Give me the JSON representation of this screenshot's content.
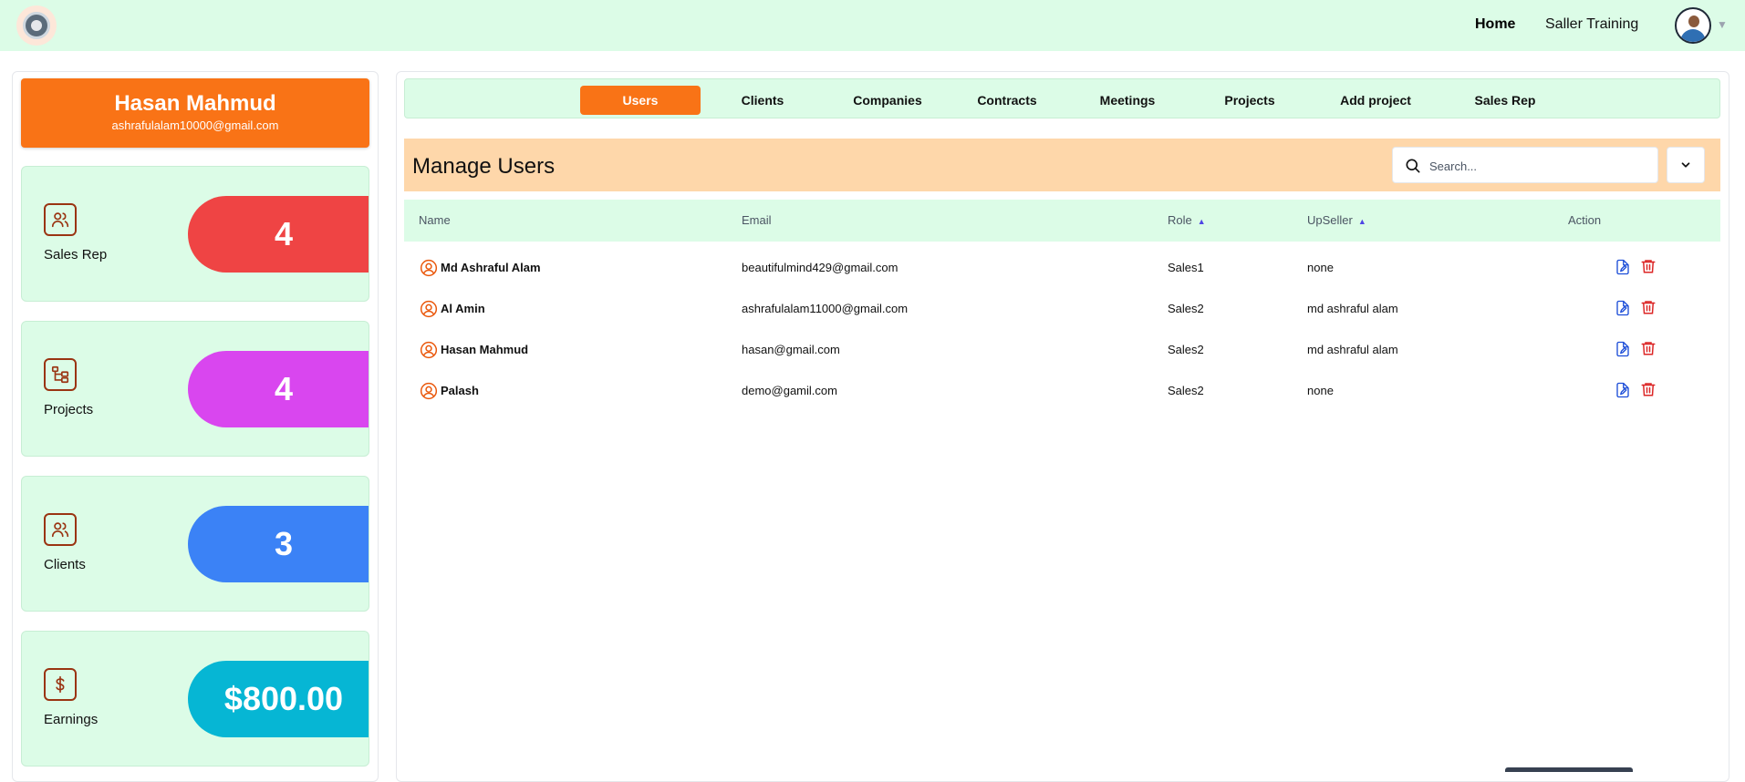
{
  "topbar": {
    "nav": {
      "home": "Home",
      "training": "Saller Training"
    }
  },
  "profile": {
    "name": "Hasan Mahmud",
    "email": "ashrafulalam10000@gmail.com"
  },
  "stats": [
    {
      "label": "Sales Rep",
      "value": "4",
      "icon": "users-icon",
      "color": "#ef4444"
    },
    {
      "label": "Projects",
      "value": "4",
      "icon": "project-tree-icon",
      "color": "#d946ef"
    },
    {
      "label": "Clients",
      "value": "3",
      "icon": "users-icon",
      "color": "#3b82f6"
    },
    {
      "label": "Earnings",
      "value": "$800.00",
      "icon": "dollar-icon",
      "color": "#06b6d4"
    }
  ],
  "tabs": {
    "active": "Users",
    "items": [
      "Users",
      "Clients",
      "Companies",
      "Contracts",
      "Meetings",
      "Projects",
      "Add project",
      "Sales Rep"
    ]
  },
  "manage": {
    "title": "Manage Users",
    "search_placeholder": "Search..."
  },
  "table": {
    "headers": {
      "name": "Name",
      "email": "Email",
      "role": "Role",
      "upseller": "UpSeller",
      "action": "Action"
    },
    "rows": [
      {
        "name": "Md Ashraful Alam",
        "email": "beautifulmind429@gmail.com",
        "role": "Sales1",
        "upseller": "none"
      },
      {
        "name": "Al Amin",
        "email": "ashrafulalam11000@gmail.com",
        "role": "Sales2",
        "upseller": "md ashraful alam"
      },
      {
        "name": "Hasan Mahmud",
        "email": "hasan@gmail.com",
        "role": "Sales2",
        "upseller": "md ashraful alam"
      },
      {
        "name": "Palash",
        "email": "demo@gamil.com",
        "role": "Sales2",
        "upseller": "none"
      }
    ]
  },
  "colors": {
    "accent": "#f97316",
    "light_green": "#dcfce7",
    "peach": "#fed7aa",
    "edit_icon": "#1d4ed8",
    "delete_icon": "#dc2626"
  }
}
